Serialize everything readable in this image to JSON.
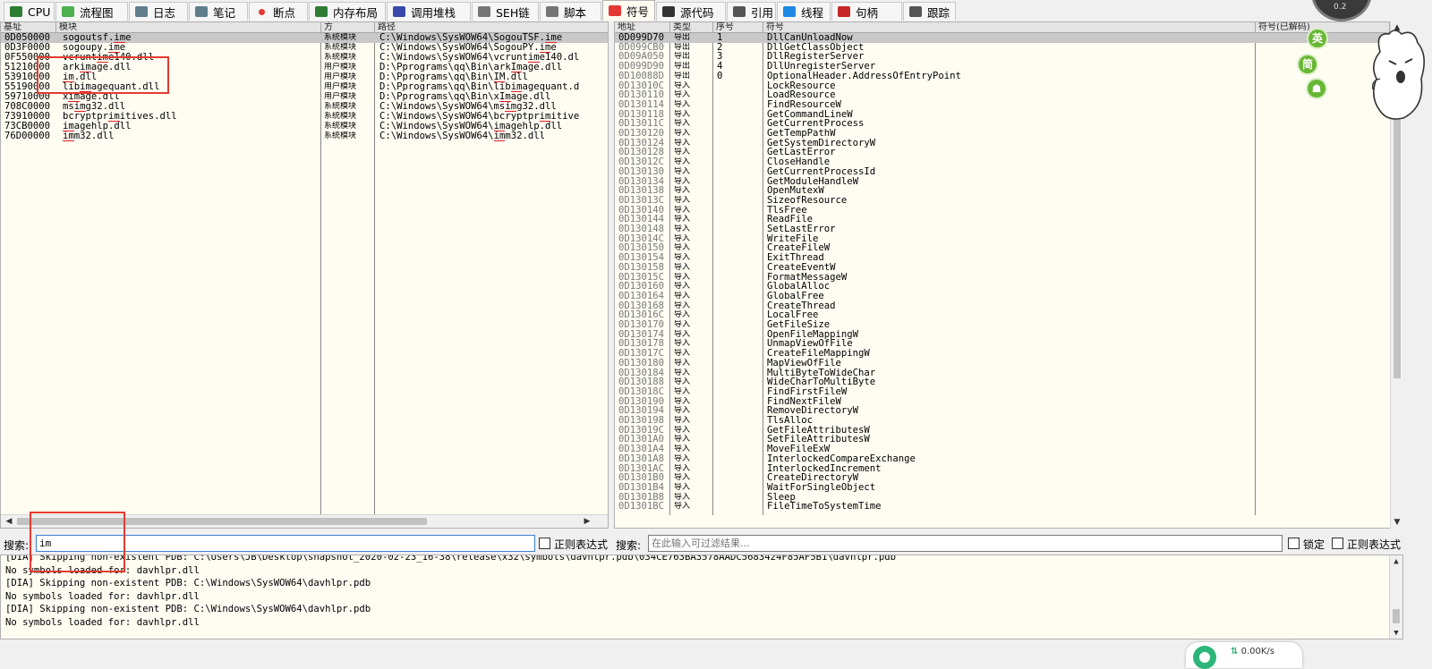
{
  "tabs": [
    {
      "label": "CPU",
      "icon": "cpu-icon",
      "color": "#2e7d32"
    },
    {
      "label": "流程图",
      "icon": "tree-icon",
      "color": "#4caf50"
    },
    {
      "label": "日志",
      "icon": "log-icon",
      "color": "#607d8b"
    },
    {
      "label": "笔记",
      "icon": "notes-icon",
      "color": "#607d8b"
    },
    {
      "label": "断点",
      "icon": "breakpoint-icon",
      "color": "#e53935"
    },
    {
      "label": "内存布局",
      "icon": "memory-map-icon",
      "color": "#2e7d32"
    },
    {
      "label": "调用堆栈",
      "icon": "call-stack-icon",
      "color": "#3949ab"
    },
    {
      "label": "SEH链",
      "icon": "seh-chain-icon",
      "color": "#757575"
    },
    {
      "label": "脚本",
      "icon": "script-icon",
      "color": "#757575"
    },
    {
      "label": "符号",
      "icon": "symbols-icon",
      "color": "#e53935"
    },
    {
      "label": "源代码",
      "icon": "source-code-icon",
      "color": "#333333"
    },
    {
      "label": "引用",
      "icon": "references-icon",
      "color": "#555555"
    },
    {
      "label": "线程",
      "icon": "threads-icon",
      "color": "#1e88e5"
    },
    {
      "label": "句柄",
      "icon": "handles-icon",
      "color": "#c62828"
    },
    {
      "label": "跟踪",
      "icon": "trace-icon",
      "color": "#555555"
    }
  ],
  "modules_panel": {
    "columns": [
      "基址",
      "模块",
      "方",
      "路径"
    ],
    "rows": [
      {
        "base": "0D050000",
        "module": "sogoutsf.ime",
        "party": "系统模块",
        "path": "C:\\Windows\\SysWOW64\\SogouTSF.ime",
        "selected": true
      },
      {
        "base": "0D3F0000",
        "module": "sogoupy.ime",
        "party": "系统模块",
        "path": "C:\\Windows\\SysWOW64\\SogouPY.ime"
      },
      {
        "base": "0F550000",
        "module": "vcruntime140.dll",
        "party": "系统模块",
        "path": "C:\\Windows\\SysWOW64\\vcruntime140.dl"
      },
      {
        "base": "51210000",
        "module": "arkimage.dll",
        "party": "用户模块",
        "path": "D:\\Pprograms\\qq\\Bin\\arkImage.dll"
      },
      {
        "base": "53910000",
        "module": "im.dll",
        "party": "用户模块",
        "path": "D:\\Pprograms\\qq\\Bin\\IM.dll"
      },
      {
        "base": "55190000",
        "module": "libimagequant.dll",
        "party": "用户模块",
        "path": "D:\\Pprograms\\qq\\Bin\\libimagequant.d"
      },
      {
        "base": "59710000",
        "module": "ximage.dll",
        "party": "用户模块",
        "path": "D:\\Pprograms\\qq\\Bin\\xImage.dll"
      },
      {
        "base": "708C0000",
        "module": "msimg32.dll",
        "party": "系统模块",
        "path": "C:\\Windows\\SysWOW64\\msimg32.dll"
      },
      {
        "base": "73910000",
        "module": "bcryptprimitives.dll",
        "party": "系统模块",
        "path": "C:\\Windows\\SysWOW64\\bcryptprimitive"
      },
      {
        "base": "73CB0000",
        "module": "imagehlp.dll",
        "party": "系统模块",
        "path": "C:\\Windows\\SysWOW64\\imagehlp.dll"
      },
      {
        "base": "76D00000",
        "module": "imm32.dll",
        "party": "系统模块",
        "path": "C:\\Windows\\SysWOW64\\imm32.dll"
      }
    ]
  },
  "symbols_panel": {
    "columns": [
      "地址",
      "类型",
      "序号",
      "符号",
      "符号(已解码)"
    ],
    "rows": [
      {
        "addr": "0D099D70",
        "type": "导出",
        "ord": "1",
        "sym": "DllCanUnloadNow",
        "selected": true
      },
      {
        "addr": "0D099CB0",
        "type": "导出",
        "ord": "2",
        "sym": "DllGetClassObject"
      },
      {
        "addr": "0D09A050",
        "type": "导出",
        "ord": "3",
        "sym": "DllRegisterServer"
      },
      {
        "addr": "0D099D90",
        "type": "导出",
        "ord": "4",
        "sym": "DllUnregisterServer"
      },
      {
        "addr": "0D10088D",
        "type": "导出",
        "ord": "0",
        "sym": "OptionalHeader.AddressOfEntryPoint"
      },
      {
        "addr": "0D13010C",
        "type": "导入",
        "ord": "",
        "sym": "LockResource"
      },
      {
        "addr": "0D130110",
        "type": "导入",
        "ord": "",
        "sym": "LoadResource"
      },
      {
        "addr": "0D130114",
        "type": "导入",
        "ord": "",
        "sym": "FindResourceW"
      },
      {
        "addr": "0D130118",
        "type": "导入",
        "ord": "",
        "sym": "GetCommandLineW"
      },
      {
        "addr": "0D13011C",
        "type": "导入",
        "ord": "",
        "sym": "GetCurrentProcess"
      },
      {
        "addr": "0D130120",
        "type": "导入",
        "ord": "",
        "sym": "GetTempPathW"
      },
      {
        "addr": "0D130124",
        "type": "导入",
        "ord": "",
        "sym": "GetSystemDirectoryW"
      },
      {
        "addr": "0D130128",
        "type": "导入",
        "ord": "",
        "sym": "GetLastError"
      },
      {
        "addr": "0D13012C",
        "type": "导入",
        "ord": "",
        "sym": "CloseHandle"
      },
      {
        "addr": "0D130130",
        "type": "导入",
        "ord": "",
        "sym": "GetCurrentProcessId"
      },
      {
        "addr": "0D130134",
        "type": "导入",
        "ord": "",
        "sym": "GetModuleHandleW"
      },
      {
        "addr": "0D130138",
        "type": "导入",
        "ord": "",
        "sym": "OpenMutexW"
      },
      {
        "addr": "0D13013C",
        "type": "导入",
        "ord": "",
        "sym": "SizeofResource"
      },
      {
        "addr": "0D130140",
        "type": "导入",
        "ord": "",
        "sym": "TlsFree"
      },
      {
        "addr": "0D130144",
        "type": "导入",
        "ord": "",
        "sym": "ReadFile"
      },
      {
        "addr": "0D130148",
        "type": "导入",
        "ord": "",
        "sym": "SetLastError"
      },
      {
        "addr": "0D13014C",
        "type": "导入",
        "ord": "",
        "sym": "WriteFile"
      },
      {
        "addr": "0D130150",
        "type": "导入",
        "ord": "",
        "sym": "CreateFileW"
      },
      {
        "addr": "0D130154",
        "type": "导入",
        "ord": "",
        "sym": "ExitThread"
      },
      {
        "addr": "0D130158",
        "type": "导入",
        "ord": "",
        "sym": "CreateEventW"
      },
      {
        "addr": "0D13015C",
        "type": "导入",
        "ord": "",
        "sym": "FormatMessageW"
      },
      {
        "addr": "0D130160",
        "type": "导入",
        "ord": "",
        "sym": "GlobalAlloc"
      },
      {
        "addr": "0D130164",
        "type": "导入",
        "ord": "",
        "sym": "GlobalFree"
      },
      {
        "addr": "0D130168",
        "type": "导入",
        "ord": "",
        "sym": "CreateThread"
      },
      {
        "addr": "0D13016C",
        "type": "导入",
        "ord": "",
        "sym": "LocalFree"
      },
      {
        "addr": "0D130170",
        "type": "导入",
        "ord": "",
        "sym": "GetFileSize"
      },
      {
        "addr": "0D130174",
        "type": "导入",
        "ord": "",
        "sym": "OpenFileMappingW"
      },
      {
        "addr": "0D130178",
        "type": "导入",
        "ord": "",
        "sym": "UnmapViewOfFile"
      },
      {
        "addr": "0D13017C",
        "type": "导入",
        "ord": "",
        "sym": "CreateFileMappingW"
      },
      {
        "addr": "0D130180",
        "type": "导入",
        "ord": "",
        "sym": "MapViewOfFile"
      },
      {
        "addr": "0D130184",
        "type": "导入",
        "ord": "",
        "sym": "MultiByteToWideChar"
      },
      {
        "addr": "0D130188",
        "type": "导入",
        "ord": "",
        "sym": "WideCharToMultiByte"
      },
      {
        "addr": "0D13018C",
        "type": "导入",
        "ord": "",
        "sym": "FindFirstFileW"
      },
      {
        "addr": "0D130190",
        "type": "导入",
        "ord": "",
        "sym": "FindNextFileW"
      },
      {
        "addr": "0D130194",
        "type": "导入",
        "ord": "",
        "sym": "RemoveDirectoryW"
      },
      {
        "addr": "0D130198",
        "type": "导入",
        "ord": "",
        "sym": "TlsAlloc"
      },
      {
        "addr": "0D13019C",
        "type": "导入",
        "ord": "",
        "sym": "GetFileAttributesW"
      },
      {
        "addr": "0D1301A0",
        "type": "导入",
        "ord": "",
        "sym": "SetFileAttributesW"
      },
      {
        "addr": "0D1301A4",
        "type": "导入",
        "ord": "",
        "sym": "MoveFileExW"
      },
      {
        "addr": "0D1301A8",
        "type": "导入",
        "ord": "",
        "sym": "InterlockedCompareExchange"
      },
      {
        "addr": "0D1301AC",
        "type": "导入",
        "ord": "",
        "sym": "InterlockedIncrement"
      },
      {
        "addr": "0D1301B0",
        "type": "导入",
        "ord": "",
        "sym": "CreateDirectoryW"
      },
      {
        "addr": "0D1301B4",
        "type": "导入",
        "ord": "",
        "sym": "WaitForSingleObject"
      },
      {
        "addr": "0D1301B8",
        "type": "导入",
        "ord": "",
        "sym": "Sleep"
      },
      {
        "addr": "0D1301BC",
        "type": "导入",
        "ord": "",
        "sym": "FileTimeToSystemTime"
      }
    ]
  },
  "search_left": {
    "label": "搜索:",
    "value": "im",
    "regex_label": "正则表达式"
  },
  "search_right": {
    "label": "搜索:",
    "placeholder": "在此输入可过滤结果...",
    "lock_label": "锁定",
    "regex_label": "正则表达式"
  },
  "log_lines": [
    "[DIA] Skipping non-existent PDB: C:\\Users\\JB\\Desktop\\snapshot_2020-02-23_16-38\\release\\x32\\symbols\\davhlpr.pdb\\034CE763BA3578AADC5683424F85AF5B1\\davhlpr.pdb",
    "No symbols loaded for: davhlpr.dll",
    "[DIA] Skipping non-existent PDB: C:\\Windows\\SysWOW64\\davhlpr.pdb",
    "No symbols loaded for: davhlpr.dll",
    "[DIA] Skipping non-existent PDB: C:\\Windows\\SysWOW64\\davhlpr.pdb",
    "No symbols loaded for: davhlpr.dll"
  ],
  "ime_buttons": {
    "english": "英",
    "simplified": "简",
    "skin": "☗"
  },
  "net_widget": {
    "speed": "0.00K/s"
  },
  "gauge": {
    "value": "0.2"
  }
}
